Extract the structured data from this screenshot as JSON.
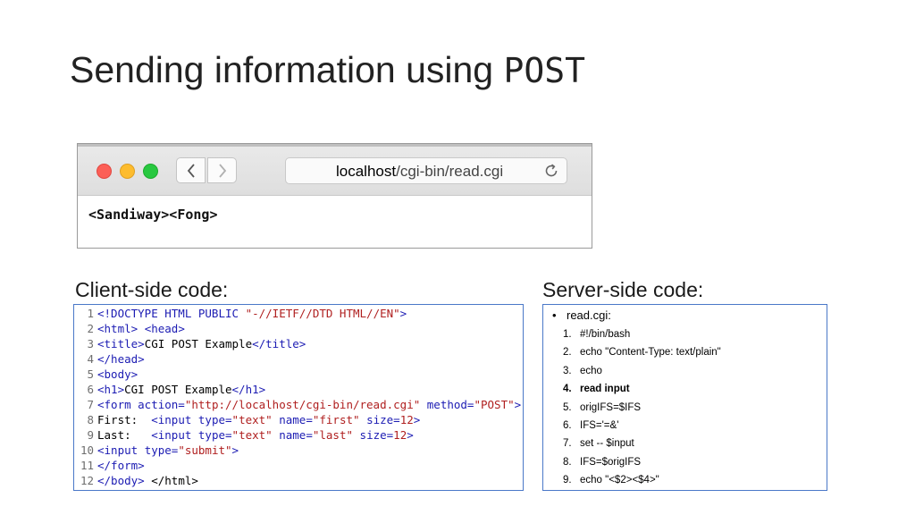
{
  "slide": {
    "title_prefix": "Sending information using ",
    "title_code": "POST"
  },
  "browser": {
    "url_host": "localhost",
    "url_path": "/cgi-bin/read.cgi",
    "page_text": "<Sandiway><Fong>",
    "icons": [
      "close-light",
      "minimize-light",
      "zoom-light",
      "back-chevron-icon",
      "forward-chevron-icon",
      "reload-icon"
    ],
    "colors": {
      "red": "#fc5f57",
      "yellow": "#fdbc2e",
      "green": "#28c840"
    }
  },
  "client": {
    "label": "Client-side code:",
    "lines": [
      {
        "num": "1",
        "parts": [
          [
            "tag",
            "<!DOCTYPE HTML PUBLIC "
          ],
          [
            "str",
            "\"-//IETF//DTD HTML//EN\""
          ],
          [
            "tag",
            ">"
          ]
        ]
      },
      {
        "num": "2",
        "parts": [
          [
            "tag",
            "<html>"
          ],
          [
            "txt",
            " "
          ],
          [
            "tag",
            "<head>"
          ]
        ]
      },
      {
        "num": "3",
        "parts": [
          [
            "tag",
            "<title>"
          ],
          [
            "txt",
            "CGI POST Example"
          ],
          [
            "tag",
            "</title>"
          ]
        ]
      },
      {
        "num": "4",
        "parts": [
          [
            "tag",
            "</head>"
          ]
        ]
      },
      {
        "num": "5",
        "parts": [
          [
            "tag",
            "<body>"
          ]
        ]
      },
      {
        "num": "6",
        "parts": [
          [
            "tag",
            "<h1>"
          ],
          [
            "txt",
            "CGI POST Example"
          ],
          [
            "tag",
            "</h1>"
          ]
        ]
      },
      {
        "num": "7",
        "parts": [
          [
            "tag",
            "<form "
          ],
          [
            "attr",
            "action="
          ],
          [
            "str",
            "\"http://localhost/cgi-bin/read.cgi\""
          ],
          [
            "attr",
            " method="
          ],
          [
            "str",
            "\"POST\""
          ],
          [
            "tag",
            ">"
          ]
        ]
      },
      {
        "num": "8",
        "parts": [
          [
            "txt",
            "First:  "
          ],
          [
            "tag",
            "<input "
          ],
          [
            "attr",
            "type="
          ],
          [
            "str",
            "\"text\""
          ],
          [
            "attr",
            " name="
          ],
          [
            "str",
            "\"first\""
          ],
          [
            "attr",
            " size="
          ],
          [
            "str",
            "12"
          ],
          [
            "tag",
            ">"
          ]
        ]
      },
      {
        "num": "9",
        "parts": [
          [
            "txt",
            "Last:   "
          ],
          [
            "tag",
            "<input "
          ],
          [
            "attr",
            "type="
          ],
          [
            "str",
            "\"text\""
          ],
          [
            "attr",
            " name="
          ],
          [
            "str",
            "\"last\""
          ],
          [
            "attr",
            " size="
          ],
          [
            "str",
            "12"
          ],
          [
            "tag",
            ">"
          ]
        ]
      },
      {
        "num": "10",
        "parts": [
          [
            "tag",
            "<input "
          ],
          [
            "attr",
            "type="
          ],
          [
            "str",
            "\"submit\""
          ],
          [
            "tag",
            ">"
          ]
        ]
      },
      {
        "num": "11",
        "parts": [
          [
            "tag",
            "</form>"
          ]
        ]
      },
      {
        "num": "12",
        "parts": [
          [
            "tag",
            "</body>"
          ],
          [
            "txt",
            " "
          ],
          [
            "txt",
            "</html>"
          ]
        ]
      }
    ]
  },
  "server": {
    "label": "Server-side code:",
    "file": "read.cgi:",
    "items": [
      {
        "num": "1.",
        "text": "#!/bin/bash",
        "bold": false
      },
      {
        "num": "2.",
        "text": "echo \"Content-Type: text/plain\"",
        "bold": false
      },
      {
        "num": "3.",
        "text": "echo",
        "bold": false
      },
      {
        "num": "4.",
        "text": "read input",
        "bold": true
      },
      {
        "num": "5.",
        "text": "origIFS=$IFS",
        "bold": false
      },
      {
        "num": "6.",
        "text": "IFS='=&'",
        "bold": false
      },
      {
        "num": "7.",
        "text": "set -- $input",
        "bold": false
      },
      {
        "num": "8.",
        "text": "IFS=$origIFS",
        "bold": false
      },
      {
        "num": "9.",
        "text": "echo \"<$2><$4>\"",
        "bold": false
      }
    ]
  }
}
